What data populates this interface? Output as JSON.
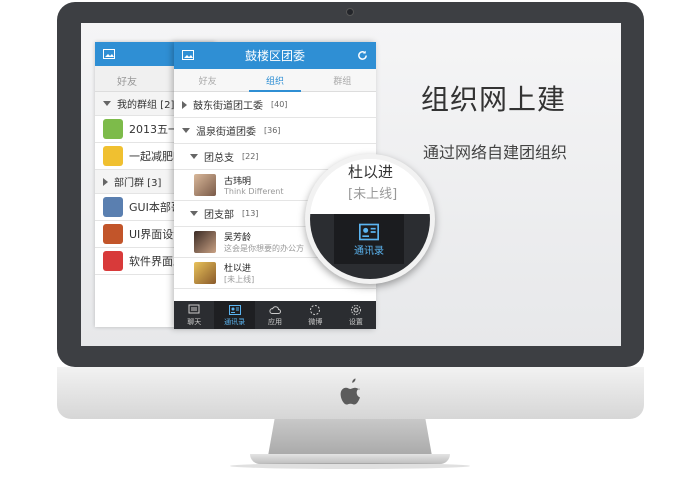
{
  "headline": "组织网上建",
  "subheadline": "通过网络自建团组织",
  "back_app": {
    "tabs": [
      "好友"
    ],
    "group_header": "我的群组 [2]",
    "dept_header": "部门群 [3]",
    "rows": [
      {
        "label": "2013五一",
        "color": "#7dbb4a"
      },
      {
        "label": "一起减肥吧",
        "color": "#f0c030"
      },
      {
        "label": "GUI本部哥",
        "color": "#5a7fb0"
      },
      {
        "label": "UI界面设计",
        "color": "#c2552a"
      },
      {
        "label": "软件界面工",
        "color": "#d83a3a"
      }
    ]
  },
  "front_app": {
    "title": "鼓楼区团委",
    "tabs": {
      "friends": "好友",
      "org": "组织",
      "groups": "群组"
    },
    "groups": [
      {
        "name": "鼓东街道团工委",
        "count": "[40]"
      },
      {
        "name": "温泉街道团委",
        "count": "[36]"
      },
      {
        "name": "团总支",
        "count": "[22]"
      },
      {
        "name": "团支部",
        "count": "[13]"
      }
    ],
    "contacts": [
      {
        "name": "古玮明",
        "status": "Think Different"
      },
      {
        "name": "吴芳龄",
        "status": "这会是你想要的办公方"
      },
      {
        "name": "杜以进",
        "status": "[未上线]"
      }
    ],
    "bottom_bar": {
      "chat": "聊天",
      "contacts": "通讯录",
      "apps": "应用",
      "weibo": "微博",
      "settings": "设置"
    }
  },
  "magnifier": {
    "name": "杜以进",
    "status": "[未上线]",
    "label": "通讯录"
  }
}
